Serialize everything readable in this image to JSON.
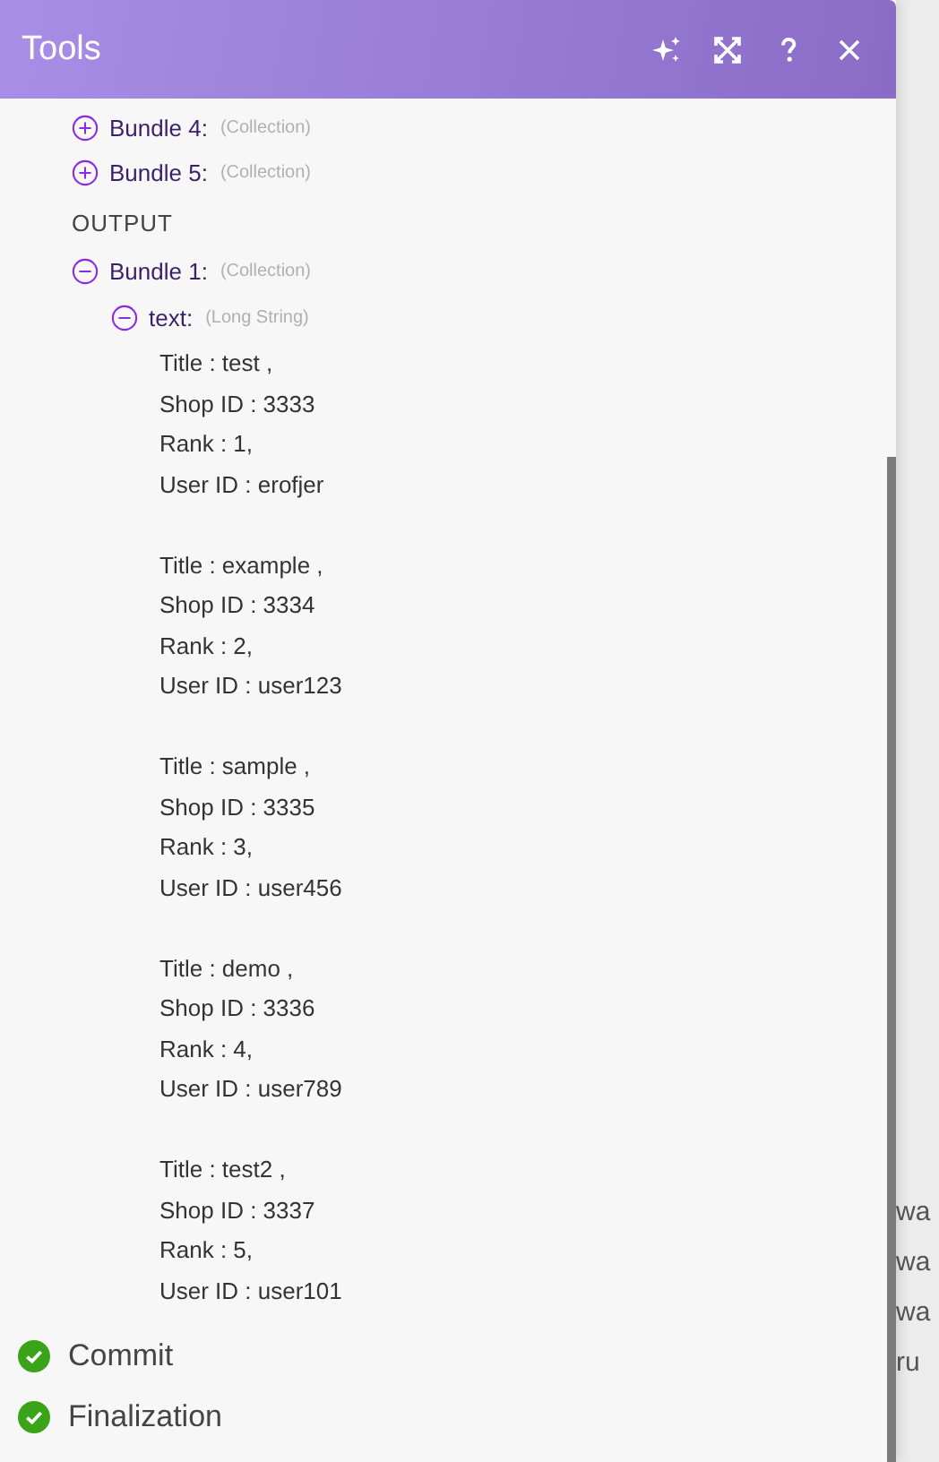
{
  "panel": {
    "title": "Tools",
    "actions": [
      {
        "kind": "sparkle"
      },
      {
        "kind": "expand"
      },
      {
        "kind": "help"
      },
      {
        "kind": "close"
      }
    ]
  },
  "input_bundles": [
    {
      "label": "Bundle 4:",
      "type": "(Collection)",
      "expanded": false
    },
    {
      "label": "Bundle 5:",
      "type": "(Collection)",
      "expanded": false
    }
  ],
  "output": {
    "heading": "OUTPUT",
    "bundles": [
      {
        "label": "Bundle 1:",
        "type": "(Collection)",
        "expanded": true,
        "children": [
          {
            "label": "text:",
            "type": "(Long String)",
            "expanded": true,
            "records": [
              [
                "Title : test ,",
                "Shop ID : 3333",
                "Rank : 1,",
                "User ID : erofjer"
              ],
              [
                "Title : example ,",
                "Shop ID : 3334",
                "Rank : 2,",
                "User ID : user123"
              ],
              [
                "Title : sample ,",
                "Shop ID : 3335",
                "Rank : 3,",
                "User ID : user456"
              ],
              [
                "Title : demo ,",
                "Shop ID : 3336",
                "Rank : 4,",
                "User ID : user789"
              ],
              [
                "Title : test2 ,",
                "Shop ID : 3337",
                "Rank : 5,",
                "User ID : user101"
              ]
            ]
          }
        ]
      }
    ]
  },
  "steps": [
    {
      "label": "Commit",
      "done": true
    },
    {
      "label": "Finalization",
      "done": true
    }
  ],
  "background_lines": [
    "wa",
    "wa",
    "wa",
    "ru"
  ]
}
